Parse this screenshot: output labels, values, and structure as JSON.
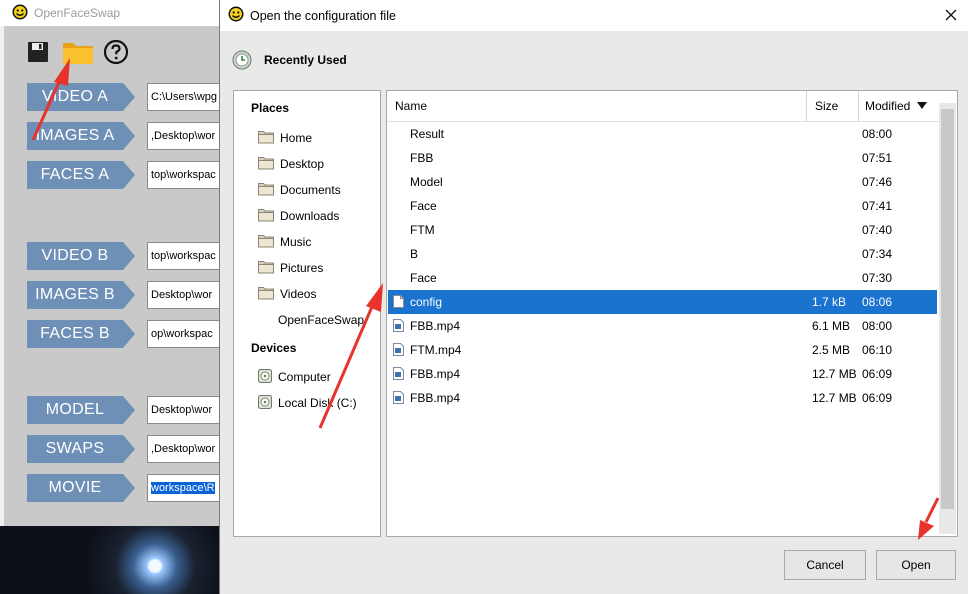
{
  "main_window": {
    "title": "OpenFaceSwap",
    "toolbar": {
      "save_icon": "floppy-disk-icon",
      "open_icon": "folder-icon",
      "help_icon": "question-circle-icon"
    },
    "rows": [
      {
        "label": "VIDEO A",
        "value": "C:\\Users\\wpg"
      },
      {
        "label": "IMAGES A",
        "value": ",Desktop\\wor"
      },
      {
        "label": "FACES A",
        "value": "top\\workspac"
      },
      {
        "label": "VIDEO B",
        "value": "top\\workspac"
      },
      {
        "label": "IMAGES B",
        "value": "Desktop\\wor"
      },
      {
        "label": "FACES B",
        "value": "op\\workspac"
      },
      {
        "label": "MODEL",
        "value": "Desktop\\wor"
      },
      {
        "label": "SWAPS",
        "value": ",Desktop\\wor"
      },
      {
        "label": "MOVIE",
        "value": "workspace\\R"
      }
    ],
    "label_color": "#6e8fb6"
  },
  "dialog": {
    "title": "Open the configuration file",
    "recently_used": "Recently Used",
    "places_heading": "Places",
    "places": [
      "Home",
      "Desktop",
      "Documents",
      "Downloads",
      "Music",
      "Pictures",
      "Videos",
      "OpenFaceSwap"
    ],
    "devices_heading": "Devices",
    "devices": [
      "Computer",
      "Local Disk (C:)"
    ],
    "columns": {
      "name": "Name",
      "size": "Size",
      "modified": "Modified"
    },
    "files": [
      {
        "name": "Result",
        "size": "",
        "modified": "08:00",
        "type": "folder"
      },
      {
        "name": "FBB",
        "size": "",
        "modified": "07:51",
        "type": "folder"
      },
      {
        "name": "Model",
        "size": "",
        "modified": "07:46",
        "type": "folder"
      },
      {
        "name": "Face",
        "size": "",
        "modified": "07:41",
        "type": "folder"
      },
      {
        "name": "FTM",
        "size": "",
        "modified": "07:40",
        "type": "folder"
      },
      {
        "name": "B",
        "size": "",
        "modified": "07:34",
        "type": "folder"
      },
      {
        "name": "Face",
        "size": "",
        "modified": "07:30",
        "type": "folder"
      },
      {
        "name": "config",
        "size": "1.7 kB",
        "modified": "08:06",
        "type": "file",
        "selected": true
      },
      {
        "name": "FBB.mp4",
        "size": "6.1 MB",
        "modified": "08:00",
        "type": "video"
      },
      {
        "name": "FTM.mp4",
        "size": "2.5 MB",
        "modified": "06:10",
        "type": "video"
      },
      {
        "name": "FBB.mp4",
        "size": "12.7 MB",
        "modified": "06:09",
        "type": "video"
      },
      {
        "name": "FBB.mp4",
        "size": "12.7 MB",
        "modified": "06:09",
        "type": "video"
      }
    ],
    "buttons": {
      "cancel": "Cancel",
      "open": "Open"
    },
    "selection_color": "#1a73cf"
  },
  "annotation_color": "#e8322c"
}
